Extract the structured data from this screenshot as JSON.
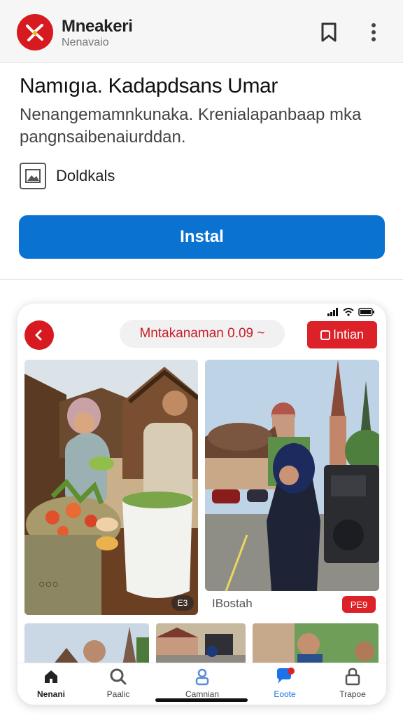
{
  "appbar": {
    "name": "Mneakeri",
    "subtitle": "Nenavaio",
    "icons": [
      "bookmark-icon",
      "more-vert-icon"
    ]
  },
  "app": {
    "title": "Namıgıa. Kadapdsans Umar",
    "description": "Nenangemamnkunaka. Krenialapanbaap mka pangnsaibenaiurddan.",
    "developer": "Doldkals",
    "install_label": "Instal"
  },
  "preview": {
    "search_text": "Mntakanaman 0.09 ~",
    "action_label": "Intian",
    "duration_badge": "E3",
    "caption": "IBostah",
    "price_badge": "PE9"
  },
  "nav": {
    "items": [
      {
        "label": "Nenani",
        "icon": "home-icon"
      },
      {
        "label": "Paalic",
        "icon": "search-icon"
      },
      {
        "label": "Camnian",
        "icon": "person-icon"
      },
      {
        "label": "Eoote",
        "icon": "chat-icon"
      },
      {
        "label": "Trapoe",
        "icon": "lock-icon"
      }
    ]
  },
  "colors": {
    "brand_red": "#d71920",
    "install_blue": "#0a72d1",
    "active_blue": "#1a73e8"
  }
}
